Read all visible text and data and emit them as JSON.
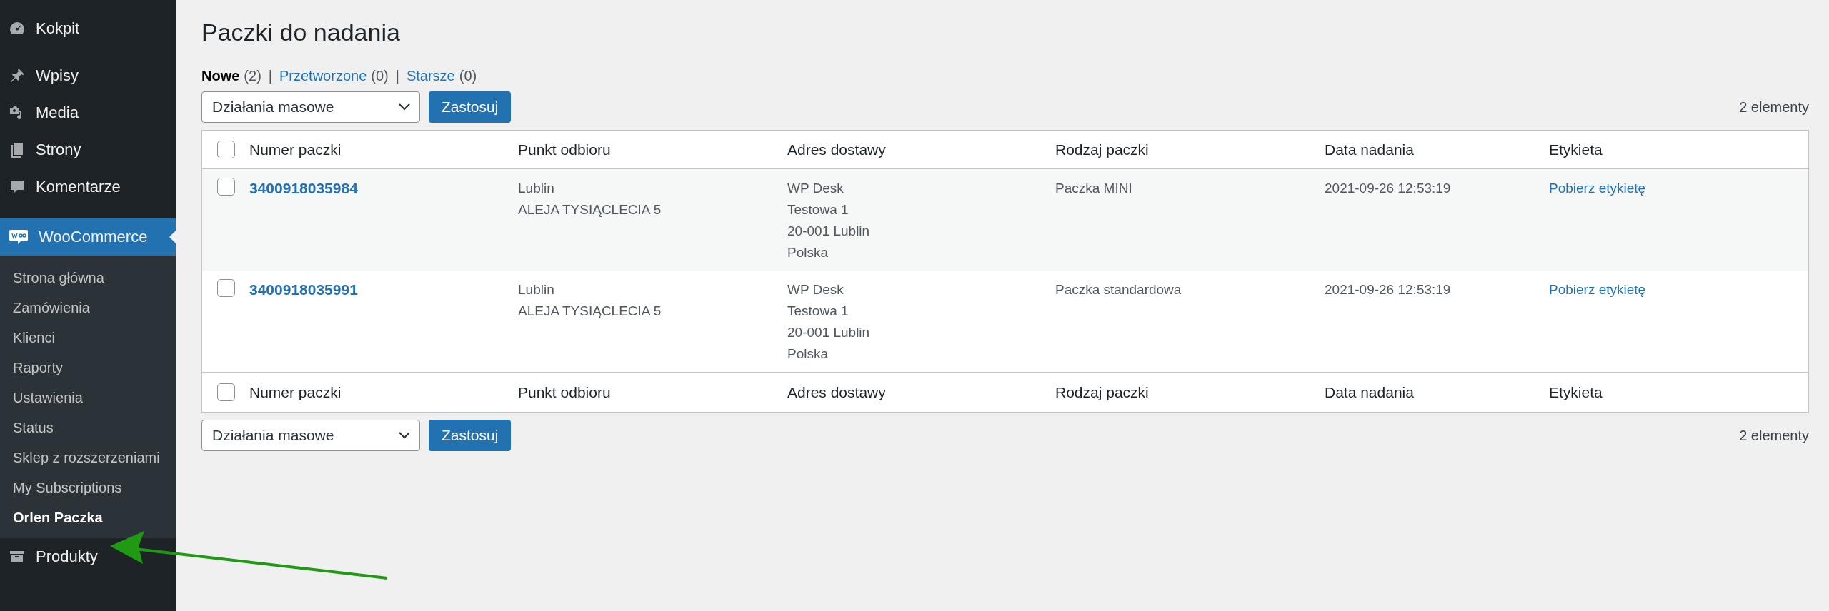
{
  "sidebar": {
    "items": [
      {
        "label": "Kokpit",
        "selected": false
      },
      {
        "label": "Wpisy",
        "selected": false
      },
      {
        "label": "Media",
        "selected": false
      },
      {
        "label": "Strony",
        "selected": false
      },
      {
        "label": "Komentarze",
        "selected": false
      },
      {
        "label": "WooCommerce",
        "selected": true,
        "children": [
          {
            "label": "Strona główna",
            "selected": false
          },
          {
            "label": "Zamówienia",
            "selected": false
          },
          {
            "label": "Klienci",
            "selected": false
          },
          {
            "label": "Raporty",
            "selected": false
          },
          {
            "label": "Ustawienia",
            "selected": false
          },
          {
            "label": "Status",
            "selected": false
          },
          {
            "label": "Sklep z rozszerzeniami",
            "selected": false
          },
          {
            "label": "My Subscriptions",
            "selected": false
          },
          {
            "label": "Orlen Paczka",
            "selected": true
          }
        ]
      },
      {
        "label": "Produkty",
        "selected": false
      }
    ]
  },
  "page": {
    "title": "Paczki do nadania",
    "views": {
      "separator": "|",
      "items": [
        {
          "label": "Nowe",
          "count": "(2)",
          "selected": true
        },
        {
          "label": "Przetworzone",
          "count": "(0)",
          "selected": false
        },
        {
          "label": "Starsze",
          "count": "(0)",
          "selected": false
        }
      ]
    },
    "top_toolbar": {
      "bulk_select": "Działania masowe",
      "apply": "Zastosuj",
      "count": "2 elementy"
    },
    "table": {
      "header_checked": false,
      "columns": [
        "Numer paczki",
        "Punkt odbioru",
        "Adres dostawy",
        "Rodzaj paczki",
        "Data nadania",
        "Etykieta"
      ],
      "rows": [
        {
          "checked": false,
          "number": "3400918035984",
          "pickup": [
            "Lublin",
            "ALEJA TYSIĄCLECIA 5"
          ],
          "address": [
            "WP Desk",
            "Testowa 1",
            "20-001 Lublin",
            "Polska"
          ],
          "type": "Paczka MINI",
          "date": "2021-09-26 12:53:19",
          "label_link": "Pobierz etykietę"
        },
        {
          "checked": false,
          "number": "3400918035991",
          "pickup": [
            "Lublin",
            "ALEJA TYSIĄCLECIA 5"
          ],
          "address": [
            "WP Desk",
            "Testowa 1",
            "20-001 Lublin",
            "Polska"
          ],
          "type": "Paczka standardowa",
          "date": "2021-09-26 12:53:19",
          "label_link": "Pobierz etykietę"
        }
      ],
      "footer_checked": false,
      "footer_columns": [
        "Numer paczki",
        "Punkt odbioru",
        "Adres dostawy",
        "Rodzaj paczki",
        "Data nadania",
        "Etykieta"
      ]
    },
    "bottom_toolbar": {
      "bulk_select": "Działania masowe",
      "apply": "Zastosuj",
      "count": "2 elementy"
    }
  }
}
